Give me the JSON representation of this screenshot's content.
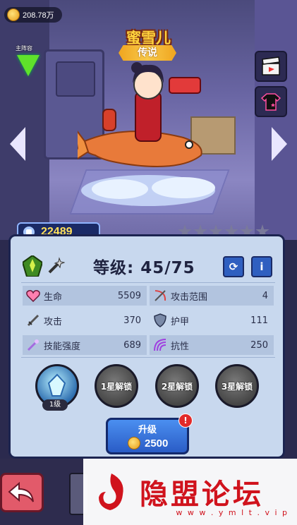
{
  "currency": {
    "amount": "208.78万",
    "icon": "coin-icon"
  },
  "lineup": {
    "label": "主阵容",
    "icon": "arrow-down-icon"
  },
  "hero": {
    "name": "蜜雪儿",
    "rarity": "传说",
    "power": "22489",
    "stars_filled": 0,
    "stars_total": 6
  },
  "level": {
    "label": "等级: 45/75"
  },
  "stats": {
    "hp": {
      "label": "生命",
      "value": "5509"
    },
    "range": {
      "label": "攻击范围",
      "value": "4"
    },
    "attack": {
      "label": "攻击",
      "value": "370"
    },
    "armor": {
      "label": "护甲",
      "value": "111"
    },
    "skill_power": {
      "label": "技能强度",
      "value": "689"
    },
    "resist": {
      "label": "抗性",
      "value": "250"
    }
  },
  "skills": [
    {
      "label": "",
      "tag": "1级"
    },
    {
      "label": "1星解锁"
    },
    {
      "label": "2星解锁"
    },
    {
      "label": "3星解锁"
    }
  ],
  "upgrade": {
    "label": "升级",
    "cost": "2500",
    "badge": "!"
  },
  "watermark": {
    "title": "隐盟论坛",
    "url": "w w w . y m l t . v i p"
  },
  "colors": {
    "gold": "#ffd23c",
    "accent_blue": "#2f5fc0",
    "panel": "#c8d8ee",
    "back_button": "#e25a6a"
  }
}
